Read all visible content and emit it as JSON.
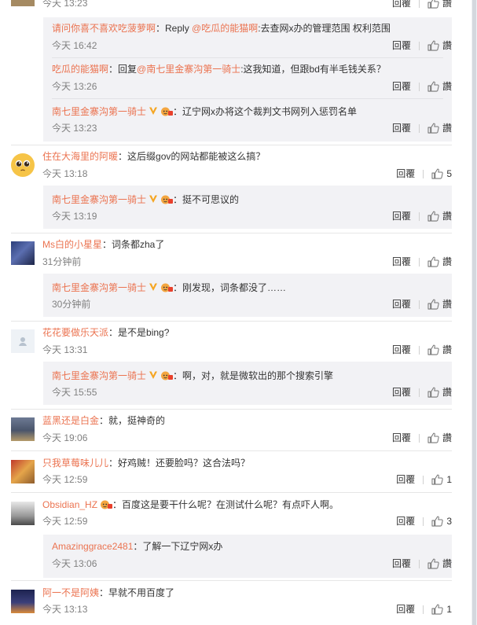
{
  "ui": {
    "reply_label": "回覆",
    "like_label": "讚"
  },
  "top_partial": {
    "time": "今天 13:23",
    "reply": "回覆",
    "like": "讚"
  },
  "thread1": {
    "replies": [
      {
        "name": "请问你喜不喜欢吃菠萝啊",
        "sep": "：Reply ",
        "mention": "@吃瓜的能猫啊",
        "text": ":去查网x办的管理范围 权利范围",
        "time": "今天 16:42"
      },
      {
        "name": "吃瓜的能猫啊",
        "sep": "：回复",
        "mention": "@南七里金寨沟第一骑士",
        "text": ":这我知道，但跟bd有半毛钱关系？",
        "time": "今天 13:26"
      },
      {
        "name": "南七里金寨沟第一骑士",
        "text": "：辽宁网x办将这个裁判文书网列入惩罚名单",
        "time": "今天 13:23"
      }
    ]
  },
  "comments": [
    {
      "name": "住在大海里的阿暖",
      "text": "：这后缀gov的网站都能被这么搞？",
      "time": "今天 13:18",
      "like": "5",
      "reply": {
        "name": "南七里金寨沟第一骑士",
        "text": "：挺不可思议的",
        "time": "今天 13:19"
      }
    },
    {
      "name": "Ms白的小星星",
      "text": "：词条都zha了",
      "time": "31分钟前",
      "like": "讚",
      "reply": {
        "name": "南七里金寨沟第一骑士",
        "text": "：刚发现，词条都没了……",
        "time": "30分钟前"
      }
    },
    {
      "name": "花花要做乐天派",
      "text": "：是不是bing?",
      "time": "今天 13:31",
      "like": "讚",
      "reply": {
        "name": "南七里金寨沟第一骑士",
        "text": "：啊，对，就是微软出的那个搜索引擎",
        "time": "今天 15:55"
      }
    },
    {
      "name": "蓝黑还是白金",
      "text": "：就，挺神奇的",
      "time": "今天 19:06",
      "like": "讚"
    },
    {
      "name": "只我草莓味儿儿",
      "text": "：好鸡贼！还要脸吗？这合法吗？",
      "time": "今天 12:59",
      "like": "1"
    },
    {
      "name": "Obsidian_HZ",
      "text": "：百度这是要干什么呢？在测试什么呢？有点吓人啊。",
      "time": "今天 12:59",
      "like": "3",
      "reply": {
        "name": "Amazinggrace2481",
        "text": "：了解一下辽宁网x办",
        "time": "今天 13:06"
      }
    },
    {
      "name": "阿一不是阿姨",
      "text": "：早就不用百度了",
      "time": "今天 13:13",
      "like": "1"
    }
  ]
}
